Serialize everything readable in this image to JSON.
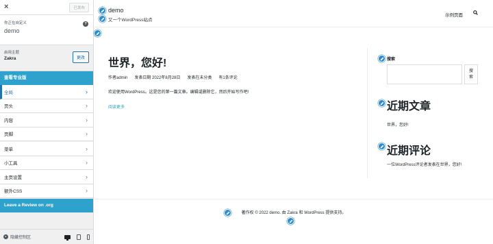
{
  "sidebar": {
    "close_label": "×",
    "published_label": "已发布",
    "customizing_label": "你正在自定义",
    "site_name": "demo",
    "help_icon": "?",
    "active_theme_label": "启用主题",
    "theme_name": "Zakra",
    "change_label": "更改",
    "upgrade_label": "查看专业版",
    "menu_group1": [
      {
        "label": "全局",
        "active": true
      },
      {
        "label": "页头"
      },
      {
        "label": "内容"
      },
      {
        "label": "页脚"
      }
    ],
    "menu_group2": [
      {
        "label": "菜单"
      },
      {
        "label": "小工具"
      },
      {
        "label": "主页设置"
      },
      {
        "label": "额外CSS"
      }
    ],
    "review_label": "Leave a Review on .org",
    "collapse_label": "隐藏控制区",
    "chevron": "›"
  },
  "preview": {
    "site_title": "demo",
    "tagline": "又一个WordPress站点",
    "nav_link": "示例页面",
    "post": {
      "title": "世界，您好!",
      "author": "作者admin",
      "date": "发表日期 2022年8月28日",
      "category": "发表在未分类",
      "comments": "有1条评论",
      "excerpt": "欢迎使用WordPress。这是您的第一篇文章。编辑或删除它，然后开始写作吧!",
      "read_more": "阅读更多"
    },
    "widgets": {
      "search_label": "搜索",
      "search_button": "搜索",
      "recent_posts_title": "近期文章",
      "recent_post_item": "世界，您好!",
      "recent_comments_title": "近期评论",
      "recent_comment_item": "一位WordPress评论者发表在世界，您好!"
    },
    "footer": "著作权 © 2022 demo. 由 Zakra 和 WordPress 提供支持。"
  },
  "colors": {
    "accent": "#2271b1",
    "brand_bar": "#2ea2cc",
    "edit_shortcut": "#2e8ccf"
  }
}
